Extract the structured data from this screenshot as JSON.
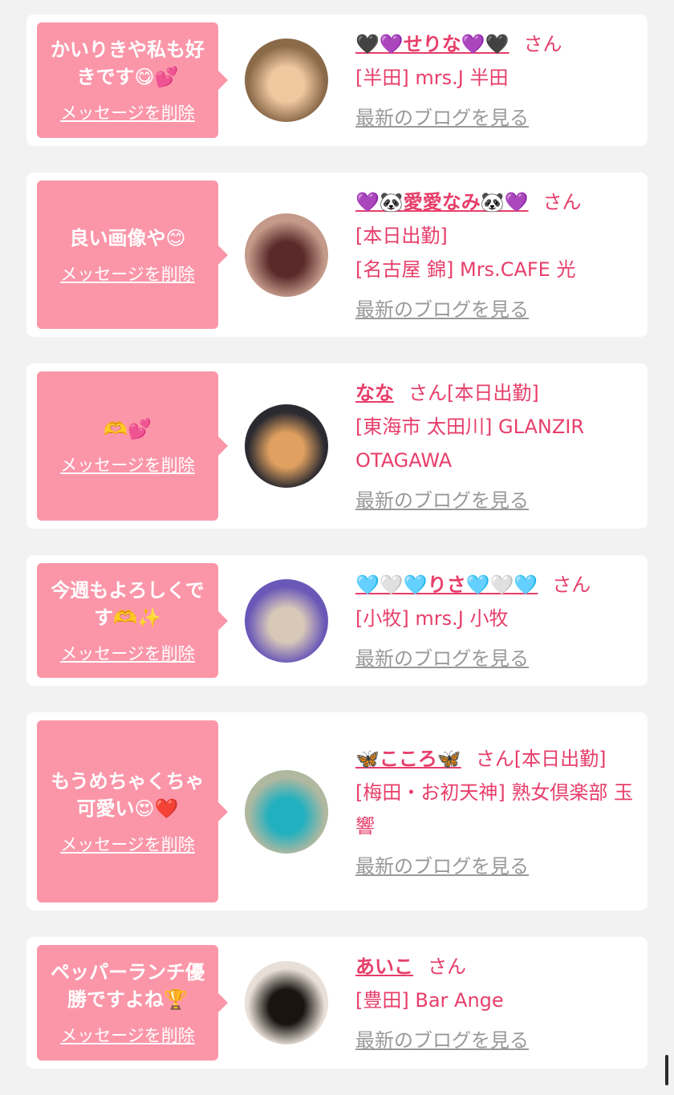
{
  "san_label": "さん",
  "delete_label": "メッセージを削除",
  "blog_label": "最新のブログを見る",
  "cards": [
    {
      "message": "かいりきや私も好きです😋💕",
      "name": "🖤💜せりな💜🖤",
      "tag": "",
      "shop": "[半田] mrs.J 半田",
      "avatar_colors": [
        "#8b6a4a",
        "#f0c8a0"
      ]
    },
    {
      "message": "良い画像や😊",
      "name": "💜🐼愛愛なみ🐼💜",
      "tag": "[本日出勤]",
      "shop": "[名古屋 錦] Mrs.CAFE 光",
      "avatar_colors": [
        "#c49a8a",
        "#5a2a2a"
      ]
    },
    {
      "message": "🫶💕",
      "name": "なな",
      "tag": "[本日出勤]",
      "shop": "[東海市 太田川] GLANZIR OTAGAWA",
      "avatar_colors": [
        "#2a2a30",
        "#e0a060"
      ]
    },
    {
      "message": "今週もよろしくです🫶✨",
      "name": "🩵🤍🩵りさ🩵🤍🩵",
      "tag": "",
      "shop": "[小牧] mrs.J 小牧",
      "avatar_colors": [
        "#6a58b8",
        "#d8c8b8"
      ]
    },
    {
      "message": "もうめちゃくちゃ可愛い😍❤️",
      "name": "🦋こころ🦋",
      "tag": "[本日出勤]",
      "shop": "[梅田・お初天神] 熟女倶楽部 玉響",
      "avatar_colors": [
        "#b0b8a0",
        "#20b0c0"
      ]
    },
    {
      "message": "ペッパーランチ優勝ですよね🏆",
      "name": "あいこ",
      "tag": "",
      "shop": "[豊田] Bar Ange",
      "avatar_colors": [
        "#e8e0d8",
        "#1a1410"
      ]
    }
  ]
}
